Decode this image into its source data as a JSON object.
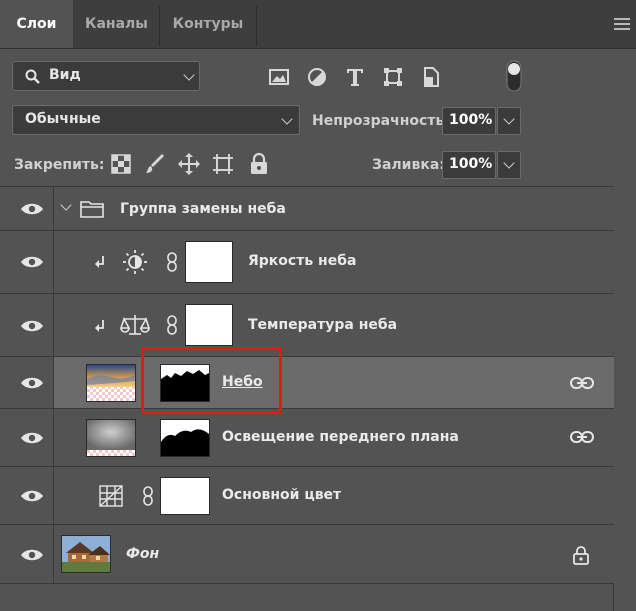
{
  "tabs": [
    {
      "label": "Слои",
      "active": true
    },
    {
      "label": "Каналы",
      "active": false
    },
    {
      "label": "Контуры",
      "active": false
    }
  ],
  "filter": {
    "kind": "Вид",
    "icons": [
      "image-filter-icon",
      "adjustment-filter-icon",
      "type-filter-icon",
      "shape-filter-icon",
      "smart-object-filter-icon",
      "filter-toggle-icon"
    ]
  },
  "blend": {
    "mode": "Обычные",
    "opacity_label": "Непрозрачность:",
    "opacity_value": "100%"
  },
  "lock": {
    "label": "Закрепить:",
    "icons": [
      "lock-transparent-pixels-icon",
      "lock-image-pixels-icon",
      "lock-position-icon",
      "lock-artboard-icon",
      "lock-all-icon"
    ],
    "fill_label": "Заливка:",
    "fill_value": "100%"
  },
  "layers": [
    {
      "name": "Группа замены неба",
      "type": "group",
      "visible": true,
      "expanded": true
    },
    {
      "name": "Яркость неба",
      "type": "adjustment",
      "adjustment_icon": "brightness-icon",
      "clipped": true,
      "visible": true
    },
    {
      "name": "Температура неба",
      "type": "adjustment",
      "adjustment_icon": "color-balance-icon",
      "clipped": true,
      "visible": true
    },
    {
      "name": "Небо",
      "type": "pixel",
      "visible": true,
      "selected": true,
      "linked": true
    },
    {
      "name": "Освещение переднего плана",
      "type": "pixel",
      "visible": true,
      "linked": true
    },
    {
      "name": "Основной цвет",
      "type": "fill",
      "adjustment_icon": "pattern-fill-icon",
      "visible": true
    },
    {
      "name": "Фон",
      "type": "background",
      "visible": true,
      "locked": true
    }
  ],
  "colors": {
    "panel": "#535353",
    "tabbar": "#3e3e3e",
    "selected_row": "#6b6b6b",
    "highlight": "#e8161b"
  }
}
